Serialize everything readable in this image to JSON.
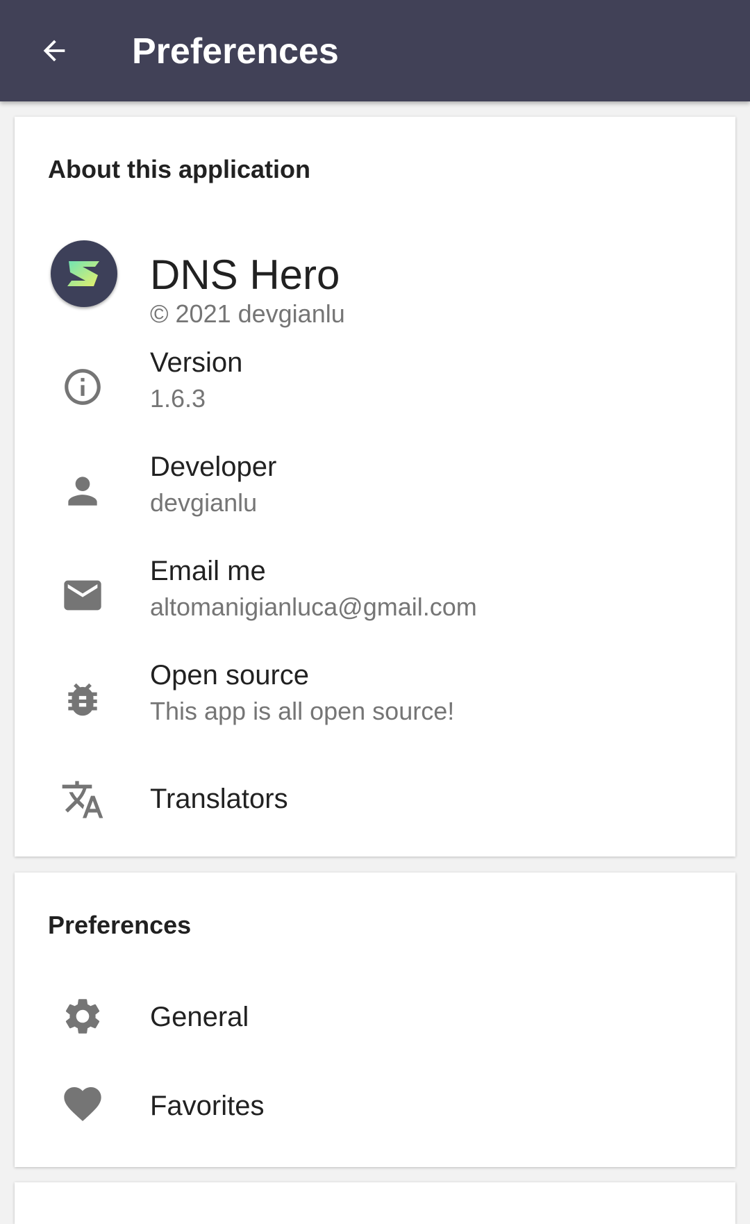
{
  "toolbar": {
    "title": "Preferences",
    "background": "#414157",
    "back_icon": "arrow-back-icon"
  },
  "about": {
    "section_title": "About this application",
    "app": {
      "name": "DNS Hero",
      "copyright": "© 2021 devgianlu",
      "logo_icon": "app-logo-icon"
    },
    "version": {
      "label": "Version",
      "value": "1.6.3",
      "icon": "info-icon"
    },
    "developer": {
      "label": "Developer",
      "value": "devgianlu",
      "icon": "person-icon"
    },
    "email": {
      "label": "Email me",
      "value": "altomanigianluca@gmail.com",
      "icon": "mail-icon"
    },
    "open_source": {
      "label": "Open source",
      "value": "This app is all open source!",
      "icon": "bug-icon"
    },
    "translators": {
      "label": "Translators",
      "icon": "translate-icon"
    }
  },
  "preferences": {
    "section_title": "Preferences",
    "general": {
      "label": "General",
      "icon": "gear-icon"
    },
    "favorites": {
      "label": "Favorites",
      "icon": "heart-icon"
    }
  },
  "colors": {
    "icon_gray": "#757575",
    "primary_text": "#212121",
    "secondary_text": "#757575"
  }
}
